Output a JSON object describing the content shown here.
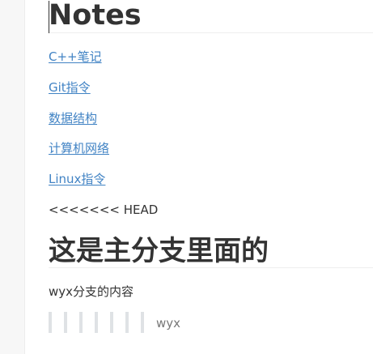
{
  "document": {
    "heading": "Notes",
    "links": [
      "C++笔记",
      "Git指令",
      "数据结构",
      "计算机网络",
      "Linux指令"
    ],
    "conflict_marker": "<<<<<<< HEAD",
    "section_heading": "这是主分支里面的",
    "branch_paragraph": "wyx分支的内容",
    "nested_quote_text": "wyx"
  },
  "colors": {
    "link": "#4183c4",
    "text": "#333333",
    "quote_bar": "#dfe2e5",
    "quote_text": "#777777"
  }
}
